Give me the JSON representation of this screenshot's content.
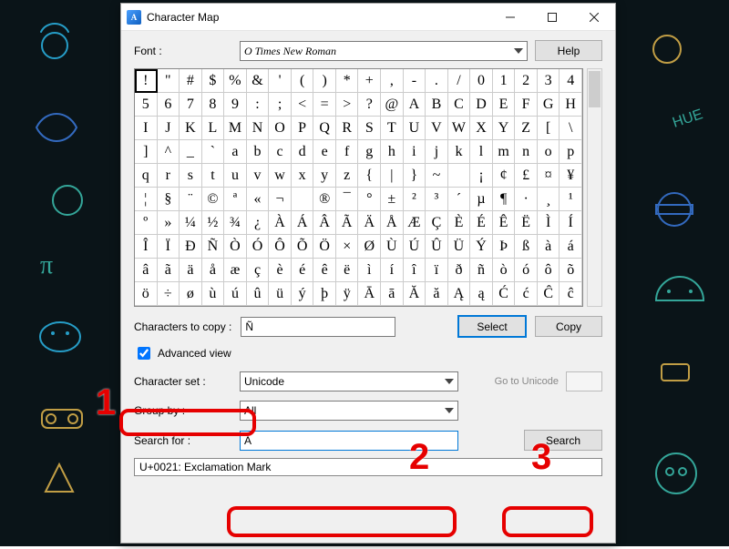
{
  "window": {
    "title": "Character Map"
  },
  "winbtns": {
    "min": "Minimize",
    "max": "Maximize",
    "close": "Close"
  },
  "labels": {
    "font": "Font :",
    "help": "Help",
    "chars_to_copy": "Characters to copy :",
    "select": "Select",
    "copy": "Copy",
    "advanced": "Advanced view",
    "charset": "Character set :",
    "groupby": "Group by :",
    "searchfor": "Search for :",
    "goto": "Go to Unicode",
    "search": "Search"
  },
  "font_value": "O Times New Roman",
  "charset_value": "Unicode",
  "groupby_value": "All",
  "search_value": "A",
  "copy_value": "Ñ",
  "advanced_checked": true,
  "status": "U+0021: Exclamation Mark",
  "annotations": {
    "n1": "1",
    "n2": "2",
    "n3": "3"
  },
  "grid": {
    "selected_index": 0,
    "chars": [
      "!",
      "\"",
      "#",
      "$",
      "%",
      "&",
      "'",
      "(",
      ")",
      "*",
      "+",
      ",",
      "-",
      ".",
      "/",
      "0",
      "1",
      "2",
      "3",
      "4",
      "5",
      "6",
      "7",
      "8",
      "9",
      ":",
      ";",
      "<",
      "=",
      ">",
      "?",
      "@",
      "A",
      "B",
      "C",
      "D",
      "E",
      "F",
      "G",
      "H",
      "I",
      "J",
      "K",
      "L",
      "M",
      "N",
      "O",
      "P",
      "Q",
      "R",
      "S",
      "T",
      "U",
      "V",
      "W",
      "X",
      "Y",
      "Z",
      "[",
      "\\",
      "]",
      "^",
      "_",
      "`",
      "a",
      "b",
      "c",
      "d",
      "e",
      "f",
      "g",
      "h",
      "i",
      "j",
      "k",
      "l",
      "m",
      "n",
      "o",
      "p",
      "q",
      "r",
      "s",
      "t",
      "u",
      "v",
      "w",
      "x",
      "y",
      "z",
      "{",
      "|",
      "}",
      "~",
      " ",
      "¡",
      "¢",
      "£",
      "¤",
      "¥",
      "¦",
      "§",
      "¨",
      "©",
      "ª",
      "«",
      "¬",
      "­",
      "®",
      "¯",
      "°",
      "±",
      "²",
      "³",
      "´",
      "µ",
      "¶",
      "·",
      "¸",
      "¹",
      "º",
      "»",
      "¼",
      "½",
      "¾",
      "¿",
      "À",
      "Á",
      "Â",
      "Ã",
      "Ä",
      "Å",
      "Æ",
      "Ç",
      "È",
      "É",
      "Ê",
      "Ë",
      "Ì",
      "Í",
      "Î",
      "Ï",
      "Ð",
      "Ñ",
      "Ò",
      "Ó",
      "Ô",
      "Õ",
      "Ö",
      "×",
      "Ø",
      "Ù",
      "Ú",
      "Û",
      "Ü",
      "Ý",
      "Þ",
      "ß",
      "à",
      "á",
      "â",
      "ã",
      "ä",
      "å",
      "æ",
      "ç",
      "è",
      "é",
      "ê",
      "ë",
      "ì",
      "í",
      "î",
      "ï",
      "ð",
      "ñ",
      "ò",
      "ó",
      "ô",
      "õ",
      "ö",
      "÷",
      "ø",
      "ù",
      "ú",
      "û",
      "ü",
      "ý",
      "þ",
      "ÿ",
      "Ā",
      "ā",
      "Ă",
      "ă",
      "Ą",
      "ą",
      "Ć",
      "ć",
      "Ĉ",
      "ĉ"
    ]
  }
}
